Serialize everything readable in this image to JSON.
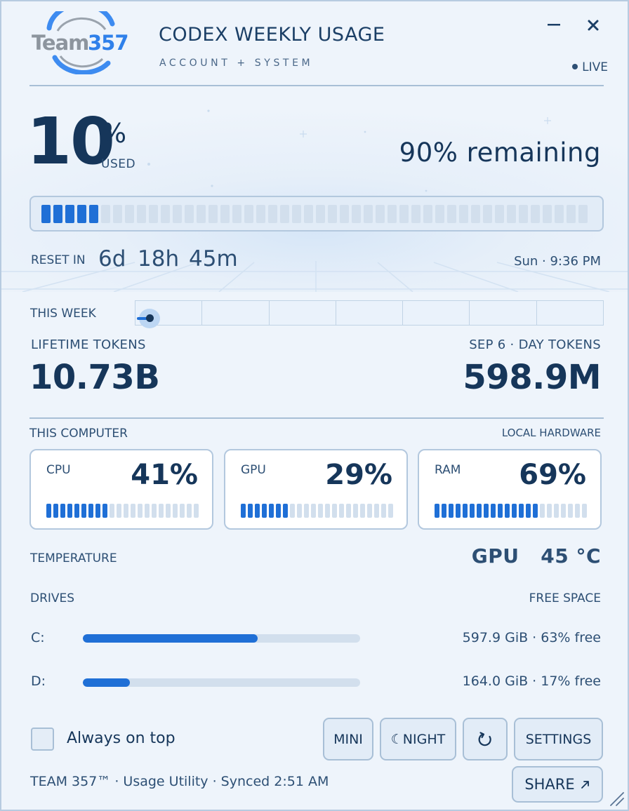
{
  "header": {
    "logo_text": "Team357",
    "title": "CODEX WEEKLY USAGE",
    "subtitle": "ACCOUNT + SYSTEM",
    "live_label": "LIVE",
    "minimize_icon": "minimize-icon",
    "close_icon": "close-icon"
  },
  "usage": {
    "used_percent": "10",
    "percent_sign": "%",
    "used_label": "USED",
    "remaining_text": "90% remaining",
    "bar_total_segments": 46,
    "bar_filled_segments": 5,
    "reset_label": "RESET IN",
    "reset_days": "6d",
    "reset_hours": "18h",
    "reset_minutes": "45m",
    "reset_at": "Sun · 9:36 PM"
  },
  "week": {
    "label": "THIS WEEK",
    "days": 7,
    "progress_fraction": 0.03
  },
  "tokens": {
    "lifetime_label": "LIFETIME TOKENS",
    "lifetime_value": "10.73B",
    "day_label": "SEP 6 · DAY TOKENS",
    "day_value": "598.9M"
  },
  "computer": {
    "label": "THIS COMPUTER",
    "right_label": "LOCAL HARDWARE",
    "cards": [
      {
        "name": "CPU",
        "value": "41%",
        "segments": 22,
        "filled": 9
      },
      {
        "name": "GPU",
        "value": "29%",
        "segments": 22,
        "filled": 7
      },
      {
        "name": "RAM",
        "value": "69%",
        "segments": 22,
        "filled": 15
      }
    ],
    "temperature_label": "TEMPERATURE",
    "temperature_value": "GPU   45 °C",
    "drives_label": "DRIVES",
    "free_space_label": "FREE SPACE",
    "drives": [
      {
        "letter": "C:",
        "used_fraction": 0.63,
        "info": "597.9 GiB · 63% free"
      },
      {
        "letter": "D:",
        "used_fraction": 0.17,
        "info": "164.0 GiB · 17% free"
      }
    ]
  },
  "controls": {
    "always_on_top_label": "Always on top",
    "always_on_top_checked": false,
    "mini_label": "MINI",
    "night_label": "☾NIGHT",
    "refresh_icon": "refresh-icon",
    "settings_label": "SETTINGS",
    "share_label": "SHARE",
    "share_icon": "external-arrow-icon"
  },
  "footer": {
    "status": "TEAM 357™ · Usage Utility · Synced 2:51 AM"
  },
  "colors": {
    "accent": "#1f6fd6",
    "text_dark": "#16365a",
    "text_muted": "#2d4f74",
    "background": "#eef4fb",
    "track": "#d2dfed",
    "border": "#a8bfd6"
  }
}
